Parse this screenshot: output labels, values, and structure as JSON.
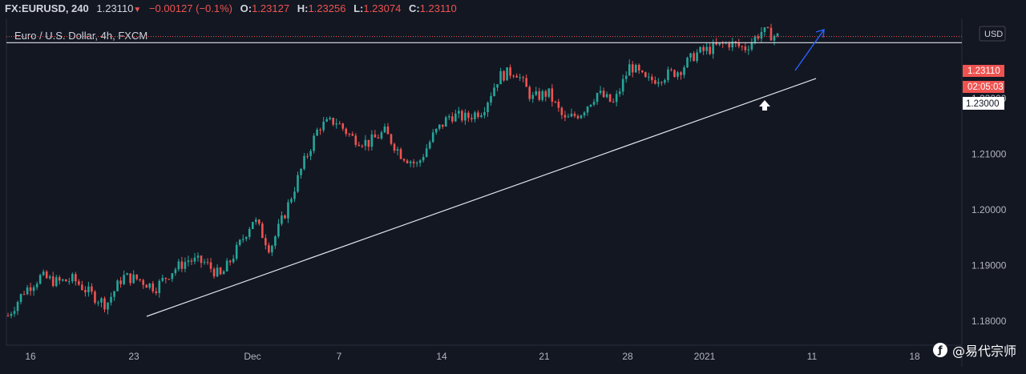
{
  "header": {
    "symbol": "FX:EURUSD, 240",
    "last": "1.23110",
    "arrow": "▼",
    "change": "−0.00127 (−0.1%)",
    "o_label": "O:",
    "o_value": "1.23127",
    "h_label": "H:",
    "h_value": "1.23256",
    "l_label": "L:",
    "l_value": "1.23074",
    "c_label": "C:",
    "c_value": "1.23110"
  },
  "chart_title": "Euro / U.S. Dollar, 4h, FXCM",
  "currency_button": "USD",
  "price_tags": {
    "last_price": "1.23110",
    "countdown": "02:05:03",
    "level": "1.23000"
  },
  "watermark": {
    "logo_text": "ƒ",
    "text": "@易代宗师"
  },
  "colors": {
    "background": "#131722",
    "up": "#26a69a",
    "down": "#ef5350",
    "axis_text": "#b2b5be",
    "trendline": "#e0e3eb",
    "arrow": "#2962ff"
  },
  "chart_data": {
    "type": "candlestick",
    "title": "Euro / U.S. Dollar, 4h, FXCM",
    "ylim": [
      1.177,
      1.2345
    ],
    "y_ticks": [
      "1.18000",
      "1.19000",
      "1.20000",
      "1.21000",
      "1.22000"
    ],
    "x_ticks": [
      "16",
      "23",
      "Dec",
      "7",
      "14",
      "21",
      "28",
      "2021",
      "11",
      "18"
    ],
    "horizontal_level": 1.23,
    "annotations": [
      "trendline",
      "up-arrow",
      "projection-arrow"
    ],
    "key_closes": [
      1.181,
      1.1855,
      1.188,
      1.187,
      1.1875,
      1.185,
      1.183,
      1.188,
      1.1875,
      1.186,
      1.189,
      1.191,
      1.1905,
      1.188,
      1.193,
      1.1985,
      1.193,
      1.2,
      1.208,
      1.215,
      1.216,
      1.213,
      1.212,
      1.214,
      1.21,
      1.208,
      1.2135,
      1.217,
      1.2165,
      1.218,
      1.224,
      1.225,
      1.22,
      1.221,
      1.216,
      1.2175,
      1.221,
      1.219,
      1.226,
      1.223,
      1.224,
      1.225,
      1.228,
      1.229,
      1.23,
      1.229,
      1.232,
      1.2311
    ]
  }
}
